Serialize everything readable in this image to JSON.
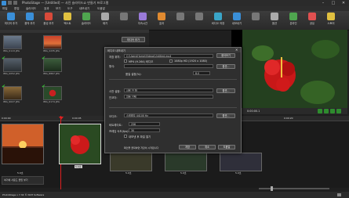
{
  "window": {
    "title": "PhotoStage — [Untitled] — 사진 슬라이드쇼 만들기 프로그램"
  },
  "menu": [
    "파일",
    "편집",
    "슬라이드",
    "효과",
    "보기",
    "도구",
    "내보내기",
    "도움말"
  ],
  "toolbar": [
    {
      "label": "미디어 추가",
      "color": "#3a8fd8"
    },
    {
      "label": "음악 추가",
      "color": "#3a8fd8"
    },
    {
      "label": "음성 추가",
      "color": "#d84a3a"
    },
    {
      "label": "텍스트",
      "color": "#e0c040"
    },
    {
      "label": "슬라이드",
      "color": "#4fa54f"
    },
    {
      "label": "제거",
      "color": "#aaaaaa"
    },
    {
      "label": "",
      "color": "#777777"
    },
    {
      "label": "지속시간",
      "color": "#9a7ad8"
    },
    {
      "label": "효과",
      "color": "#e08a30"
    },
    {
      "label": "",
      "color": "#777777"
    },
    {
      "label": "",
      "color": "#777777"
    },
    {
      "label": "비디오 저장",
      "color": "#3aa5c8"
    },
    {
      "label": "내보내기",
      "color": "#3a8fd8"
    },
    {
      "label": "",
      "color": "#777777"
    },
    {
      "label": "옵션",
      "color": "#aaaaaa"
    },
    {
      "label": "온라인",
      "color": "#4fa54f"
    },
    {
      "label": "공유",
      "color": "#e05050"
    },
    {
      "label": "스토어",
      "color": "#e0c040"
    }
  ],
  "media_panel": {
    "add_button": "미디어 추가",
    "items": [
      "IMG_0113.JPG",
      "IMG_2235.JPG",
      "IMG_0052.JPG",
      "IMG_8867.JPG",
      "IMG_9027.JPG",
      "IMG_6174.JPG"
    ]
  },
  "preview": {
    "time": "0:00:00.1"
  },
  "timeline": {
    "ruler": [
      "0:00:00",
      "0:00:05",
      "0:00:10",
      "0:00:15",
      "0:00:20"
    ],
    "slides": [
      "5.0초",
      "5.0초",
      "5.0초",
      "5.0초",
      "5.0초"
    ],
    "audio_hint": "여기에 사운드 클립 넣기"
  },
  "status": "PhotoStage v 7.34 © NCH Software",
  "dialog": {
    "title": "비디오 내보내기",
    "path_label": "저장 위치:",
    "path_value": "C:\\Users\\Home\\Videos\\Untitled.mp4",
    "browse": "찾아보기",
    "format_label": "형식:",
    "format_opt1": "MP4 (H.264) 비디오",
    "format_opt2": "1080p HD (1920 x 1080)",
    "options": "옵션...",
    "quality_label": "품질 설정(%):",
    "quality_value": "8.0",
    "preset_label": "사전 설정:",
    "preset_value": "사용 안 함",
    "encoder_label": "인코더:",
    "encoder_value": "자동 선택",
    "audio_label": "오디오:",
    "audio_value": "스테레오 44100 Hz",
    "bitrate_label": "비트레이트:",
    "bitrate_value": "256",
    "rate_label": "프레임 속도(fps):",
    "rate_value": "30",
    "check_label": "내보낸 후 파일 열기",
    "hint": "확인을 클릭하면 저장이 시작됩니다",
    "ok": "저장",
    "cancel": "취소",
    "help": "도움말"
  }
}
